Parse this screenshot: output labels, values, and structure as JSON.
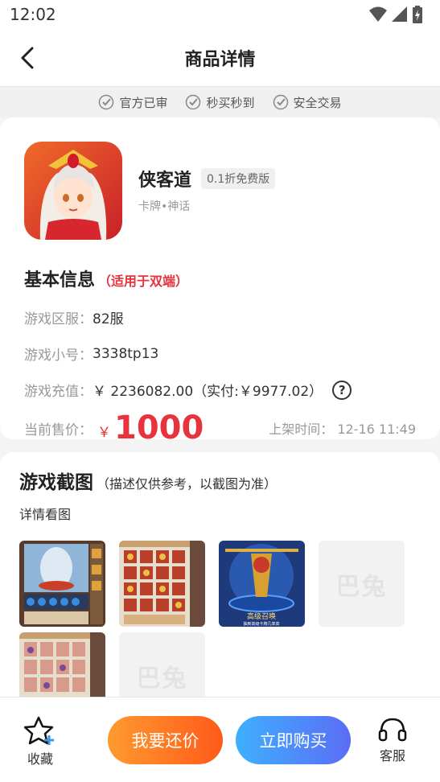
{
  "status": {
    "time": "12:02"
  },
  "nav": {
    "title": "商品详情"
  },
  "guarantees": [
    "官方已审",
    "秒买秒到",
    "安全交易"
  ],
  "game": {
    "name": "侠客道",
    "tag": "0.1折免费版",
    "category": "卡牌•神话"
  },
  "basic_info": {
    "title": "基本信息",
    "note": "（适用于双端）",
    "server_label": "游戏区服：",
    "server_value": "82服",
    "account_label": "游戏小号：",
    "account_value": "3338tp13",
    "recharge_label": "游戏充值：",
    "recharge_value": "￥ 2236082.00（实付:￥9977.02）",
    "price_label": "当前售价：",
    "price_currency": "￥",
    "price_value": "1000",
    "list_time_label": "上架时间：",
    "list_time_value": "12-16 11:49"
  },
  "screenshots": {
    "title": "游戏截图",
    "note": "（描述仅供参考，以截图为准）",
    "subtitle": "详情看图",
    "placeholder_text": "巴兔",
    "overlay_title": "高级召唤",
    "overlay_sub": "抽到高级卡牌几率高"
  },
  "bottom": {
    "favorite": "收藏",
    "bargain": "我要还价",
    "buy": "立即购买",
    "service": "客服"
  },
  "colors": {
    "accent_red": "#e8323c",
    "bargain_orange": "#ff7a22",
    "buy_blue": "#4a90f5"
  }
}
